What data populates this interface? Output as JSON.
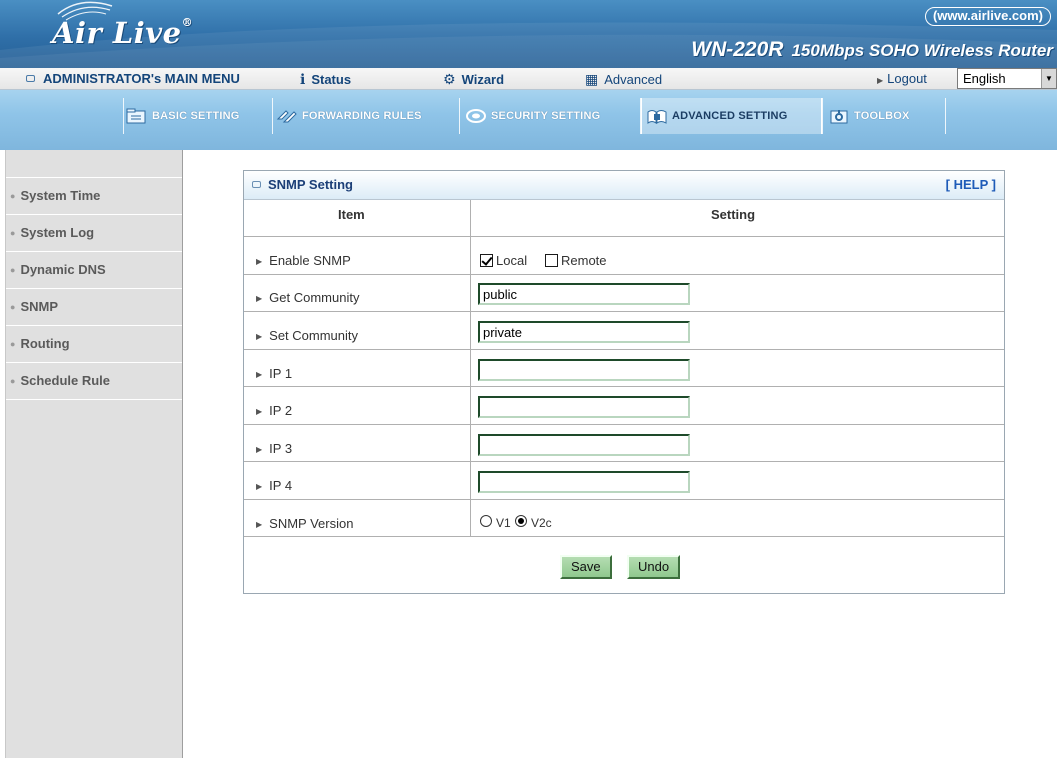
{
  "header": {
    "logo_text": "Air Live",
    "site_url": "(www.airlive.com)",
    "model": "WN-220R",
    "model_desc": "150Mbps SOHO Wireless Router"
  },
  "main_menu": {
    "admin": "ADMINISTRATOR's MAIN MENU",
    "status": "Status",
    "wizard": "Wizard",
    "advanced": "Advanced",
    "logout": "Logout",
    "language": "English"
  },
  "tabs": [
    {
      "label": "BASIC SETTING",
      "icon": "folder-icon"
    },
    {
      "label": "FORWARDING RULES",
      "icon": "arrow-icon"
    },
    {
      "label": "SECURITY SETTING",
      "icon": "shield-icon"
    },
    {
      "label": "ADVANCED SETTING",
      "icon": "stack-icon",
      "active": true
    },
    {
      "label": "TOOLBOX",
      "icon": "tools-icon"
    }
  ],
  "sidebar": {
    "items": [
      {
        "label": "System Time"
      },
      {
        "label": "System Log"
      },
      {
        "label": "Dynamic DNS"
      },
      {
        "label": "SNMP"
      },
      {
        "label": "Routing"
      },
      {
        "label": "Schedule Rule"
      }
    ]
  },
  "panel": {
    "title": "SNMP Setting",
    "help": "[ HELP ]",
    "col_item": "Item",
    "col_setting": "Setting",
    "rows": {
      "enable": {
        "label": "Enable SNMP",
        "local_label": "Local",
        "local_checked": true,
        "remote_label": "Remote",
        "remote_checked": false
      },
      "get_community": {
        "label": "Get Community",
        "value": "public"
      },
      "set_community": {
        "label": "Set Community",
        "value": "private"
      },
      "ip1": {
        "label": "IP 1",
        "value": ""
      },
      "ip2": {
        "label": "IP 2",
        "value": ""
      },
      "ip3": {
        "label": "IP 3",
        "value": ""
      },
      "ip4": {
        "label": "IP 4",
        "value": ""
      },
      "version": {
        "label": "SNMP Version",
        "v1_label": "V1",
        "v2c_label": "V2c",
        "selected": "V2c"
      }
    },
    "save_label": "Save",
    "undo_label": "Undo"
  },
  "colors": {
    "banner": "#2f6fa8",
    "tab_band": "#8fc4e8",
    "button_green": "#a2d3a0",
    "menu_text": "#14457a"
  }
}
